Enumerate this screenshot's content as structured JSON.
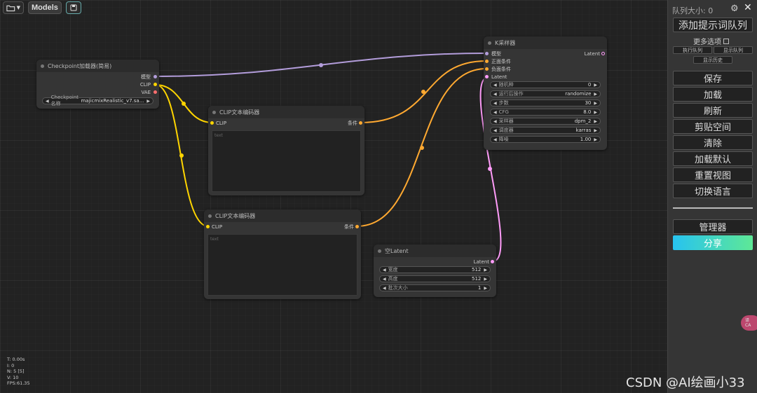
{
  "toolbar": {
    "folder_icon": "folder-icon",
    "models_label": "Models",
    "save_icon": "save-icon"
  },
  "nodes": {
    "checkpoint": {
      "title": "Checkpoint加载器(简易)",
      "outputs": [
        "模型",
        "CLIP",
        "VAE"
      ],
      "widget_label": "Checkpoint名称",
      "widget_value": "majicmixRealistic_v7.sa..."
    },
    "clip1": {
      "title": "CLIP文本编码器",
      "input": "CLIP",
      "output": "条件",
      "placeholder": "text"
    },
    "clip2": {
      "title": "CLIP文本编码器",
      "input": "CLIP",
      "output": "条件",
      "placeholder": "text"
    },
    "ksampler": {
      "title": "K采样器",
      "inputs": [
        "模型",
        "正面条件",
        "负面条件",
        "Latent"
      ],
      "output": "Latent",
      "widgets": [
        {
          "label": "随机种",
          "value": "0"
        },
        {
          "label": "运行后操作",
          "value": "randomize"
        },
        {
          "label": "步数",
          "value": "30"
        },
        {
          "label": "CFG",
          "value": "8.0"
        },
        {
          "label": "采样器",
          "value": "dpm_2"
        },
        {
          "label": "调度器",
          "value": "karras"
        },
        {
          "label": "降噪",
          "value": "1.00"
        }
      ]
    },
    "empty_latent": {
      "title": "空Latent",
      "output": "Latent",
      "widgets": [
        {
          "label": "宽度",
          "value": "512"
        },
        {
          "label": "高度",
          "value": "512"
        },
        {
          "label": "批次大小",
          "value": "1"
        }
      ]
    }
  },
  "panel": {
    "queue_size": "队列大小: 0",
    "queue_prompt": "添加提示词队列",
    "more_options": "更多选项",
    "run_queue": "执行队列",
    "show_queue": "显示队列",
    "show_history": "显示历史",
    "buttons": [
      "保存",
      "加载",
      "刷新",
      "剪贴空间",
      "清除",
      "加载默认",
      "重置视图",
      "切换语言"
    ],
    "manager": "管理器",
    "share": "分享"
  },
  "stats": {
    "t": "T: 0.00s",
    "i": "I: 0",
    "n": "N: 5 [5]",
    "v": "V: 10",
    "fps": "FPS:61.35"
  },
  "watermark": "CSDN @AI绘画小33",
  "pill_text": "译\nCA",
  "colors": {
    "model_link": "#b39ddb",
    "clip_link": "#ffd500",
    "cond_link": "#ffa931",
    "latent_link": "#ff9cf9",
    "vae_dot": "#ff6e6e",
    "share_gradient_start": "#27c3f0",
    "share_gradient_end": "#5ee896"
  }
}
